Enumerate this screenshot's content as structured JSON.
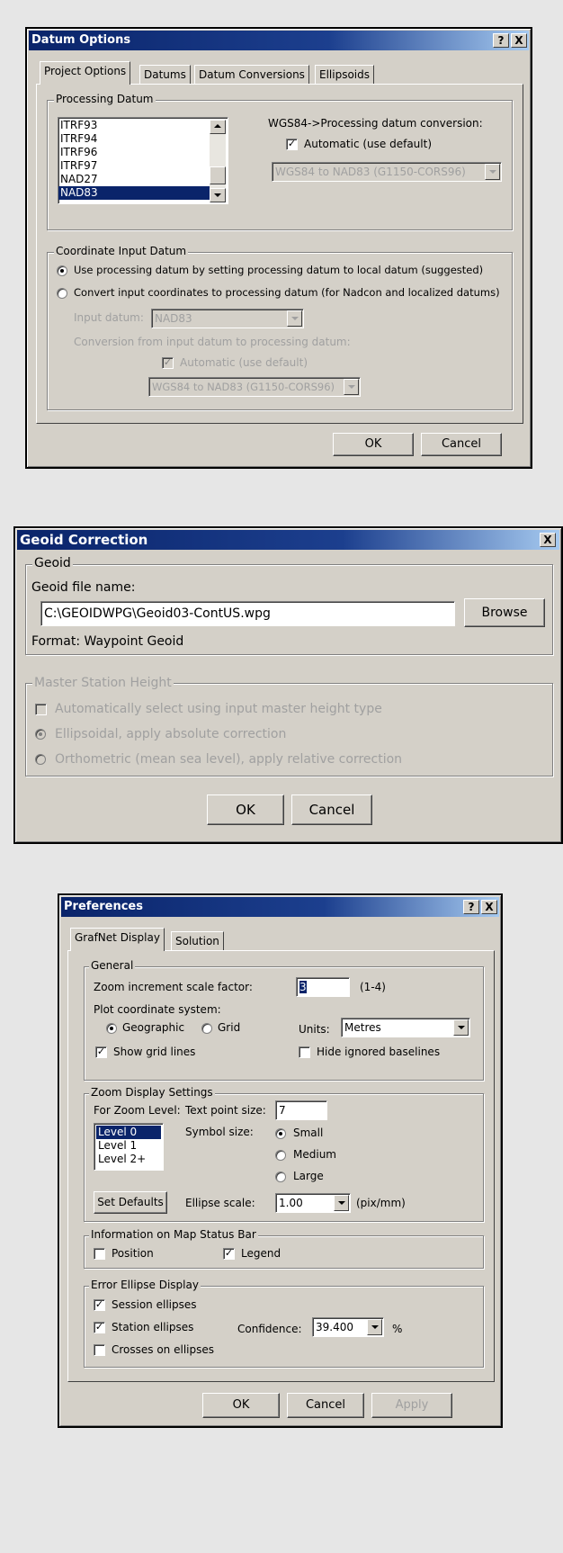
{
  "datum_dialog": {
    "title": "Datum Options",
    "help_btn": "?",
    "close_btn": "X",
    "tabs": [
      "Project Options",
      "Datums",
      "Datum Conversions",
      "Ellipsoids"
    ],
    "processing_group": "Processing Datum",
    "datum_list": [
      "ITRF93",
      "ITRF94",
      "ITRF96",
      "ITRF97",
      "NAD27",
      "NAD83"
    ],
    "conversion_label": "WGS84->Processing datum conversion:",
    "automatic_label": "Automatic (use default)",
    "conversion_value": "WGS84 to NAD83 (G1150-CORS96)",
    "input_group": "Coordinate Input Datum",
    "radio_use": "Use processing datum by setting processing datum to local datum (suggested)",
    "radio_convert": "Convert input coordinates to processing datum (for Nadcon and localized datums)",
    "input_datum_label": "Input datum:",
    "input_datum_value": "NAD83",
    "conv_in_to_proc": "Conversion from input datum to processing datum:",
    "automatic_label2": "Automatic (use default)",
    "conversion_value2": "WGS84 to NAD83 (G1150-CORS96)",
    "ok": "OK",
    "cancel": "Cancel"
  },
  "geoid_dialog": {
    "title": "Geoid Correction",
    "close_btn": "X",
    "geoid_group": "Geoid",
    "file_label": "Geoid file name:",
    "file_value": "C:\\GEOIDWPG\\Geoid03-ContUS.wpg",
    "browse": "Browse",
    "format": "Format: Waypoint Geoid",
    "master_group": "Master Station Height",
    "auto_select": "Automatically select using input master height type",
    "ellipsoidal": "Ellipsoidal, apply absolute correction",
    "orthometric": "Orthometric (mean sea level), apply relative correction",
    "ok": "OK",
    "cancel": "Cancel"
  },
  "pref_dialog": {
    "title": "Preferences",
    "help_btn": "?",
    "close_btn": "X",
    "tabs": [
      "GrafNet Display",
      "Solution"
    ],
    "general_group": "General",
    "zoom_label": "Zoom increment scale factor:",
    "zoom_value": "3",
    "zoom_range": "(1-4)",
    "plot_label": "Plot coordinate system:",
    "geographic": "Geographic",
    "grid": "Grid",
    "units_label": "Units:",
    "units_value": "Metres",
    "show_grid": "Show grid lines",
    "hide_ignored": "Hide ignored baselines",
    "zoom_group": "Zoom Display Settings",
    "for_zoom": "For Zoom Level:",
    "levels": [
      "Level 0",
      "Level 1",
      "Level 2+"
    ],
    "text_point": "Text point size:",
    "text_point_value": "7",
    "symbol_size": "Symbol size:",
    "small": "Small",
    "medium": "Medium",
    "large": "Large",
    "set_defaults": "Set Defaults",
    "ellipse_scale": "Ellipse scale:",
    "ellipse_value": "1.00",
    "ellipse_unit": "(pix/mm)",
    "info_group": "Information on Map Status Bar",
    "position": "Position",
    "legend": "Legend",
    "error_group": "Error Ellipse Display",
    "session_ellipses": "Session ellipses",
    "station_ellipses": "Station ellipses",
    "confidence_label": "Confidence:",
    "confidence_value": "39.400",
    "percent": "%",
    "crosses": "Crosses on ellipses",
    "ok": "OK",
    "cancel": "Cancel",
    "apply": "Apply"
  }
}
